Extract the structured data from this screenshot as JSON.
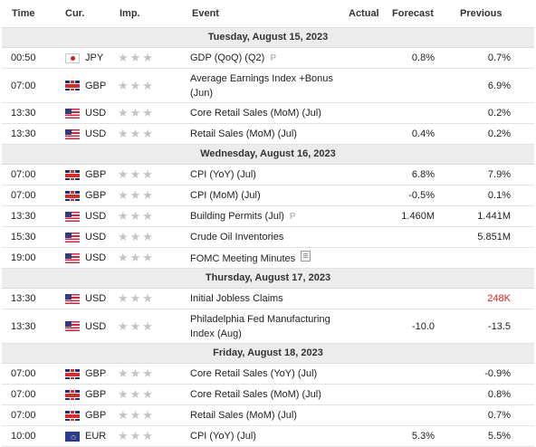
{
  "header": {
    "time": "Time",
    "cur": "Cur.",
    "imp": "Imp.",
    "event": "Event",
    "actual": "Actual",
    "forecast": "Forecast",
    "previous": "Previous"
  },
  "days": [
    {
      "date": "Tuesday, August 15, 2023",
      "rows": [
        {
          "time": "00:50",
          "cur": "JPY",
          "flag": "jpy",
          "event": "GDP (QoQ) (Q2)",
          "icon": "preliminary-icon",
          "forecast": "0.8%",
          "previous": "0.7%",
          "tall": false
        },
        {
          "time": "07:00",
          "cur": "GBP",
          "flag": "gbp",
          "event": "Average Earnings Index +Bonus (Jun)",
          "icon": "",
          "forecast": "",
          "previous": "6.9%",
          "tall": true
        },
        {
          "time": "13:30",
          "cur": "USD",
          "flag": "usd",
          "event": "Core Retail Sales (MoM) (Jul)",
          "icon": "",
          "forecast": "",
          "previous": "0.2%",
          "tall": false
        },
        {
          "time": "13:30",
          "cur": "USD",
          "flag": "usd",
          "event": "Retail Sales (MoM) (Jul)",
          "icon": "",
          "forecast": "0.4%",
          "previous": "0.2%",
          "tall": false
        }
      ]
    },
    {
      "date": "Wednesday, August 16, 2023",
      "rows": [
        {
          "time": "07:00",
          "cur": "GBP",
          "flag": "gbp",
          "event": "CPI (YoY) (Jul)",
          "icon": "",
          "forecast": "6.8%",
          "previous": "7.9%",
          "tall": false
        },
        {
          "time": "07:00",
          "cur": "GBP",
          "flag": "gbp",
          "event": "CPI (MoM) (Jul)",
          "icon": "",
          "forecast": "-0.5%",
          "previous": "0.1%",
          "tall": false
        },
        {
          "time": "13:30",
          "cur": "USD",
          "flag": "usd",
          "event": "Building Permits (Jul)",
          "icon": "preliminary-icon",
          "forecast": "1.460M",
          "previous": "1.441M",
          "tall": false
        },
        {
          "time": "15:30",
          "cur": "USD",
          "flag": "usd",
          "event": "Crude Oil Inventories",
          "icon": "",
          "forecast": "",
          "previous": "5.851M",
          "tall": false
        },
        {
          "time": "19:00",
          "cur": "USD",
          "flag": "usd",
          "event": "FOMC Meeting Minutes",
          "icon": "document-icon",
          "forecast": "",
          "previous": "",
          "tall": false
        }
      ]
    },
    {
      "date": "Thursday, August 17, 2023",
      "rows": [
        {
          "time": "13:30",
          "cur": "USD",
          "flag": "usd",
          "event": "Initial Jobless Claims",
          "icon": "",
          "forecast": "",
          "previous": "248K",
          "previous_color": "red",
          "tall": false
        },
        {
          "time": "13:30",
          "cur": "USD",
          "flag": "usd",
          "event": "Philadelphia Fed Manufacturing Index (Aug)",
          "icon": "",
          "forecast": "-10.0",
          "previous": "-13.5",
          "tall": true
        }
      ]
    },
    {
      "date": "Friday, August 18, 2023",
      "rows": [
        {
          "time": "07:00",
          "cur": "GBP",
          "flag": "gbp",
          "event": "Core Retail Sales (YoY) (Jul)",
          "icon": "",
          "forecast": "",
          "previous": "-0.9%",
          "tall": false
        },
        {
          "time": "07:00",
          "cur": "GBP",
          "flag": "gbp",
          "event": "Core Retail Sales (MoM) (Jul)",
          "icon": "",
          "forecast": "",
          "previous": "0.8%",
          "tall": false
        },
        {
          "time": "07:00",
          "cur": "GBP",
          "flag": "gbp",
          "event": "Retail Sales (MoM) (Jul)",
          "icon": "",
          "forecast": "",
          "previous": "0.7%",
          "tall": false
        },
        {
          "time": "10:00",
          "cur": "EUR",
          "flag": "eur",
          "event": "CPI (YoY) (Jul)",
          "icon": "",
          "forecast": "5.3%",
          "previous": "5.5%",
          "tall": false
        }
      ]
    }
  ],
  "importance_glyph": "★★★",
  "preliminary_glyph": "P"
}
